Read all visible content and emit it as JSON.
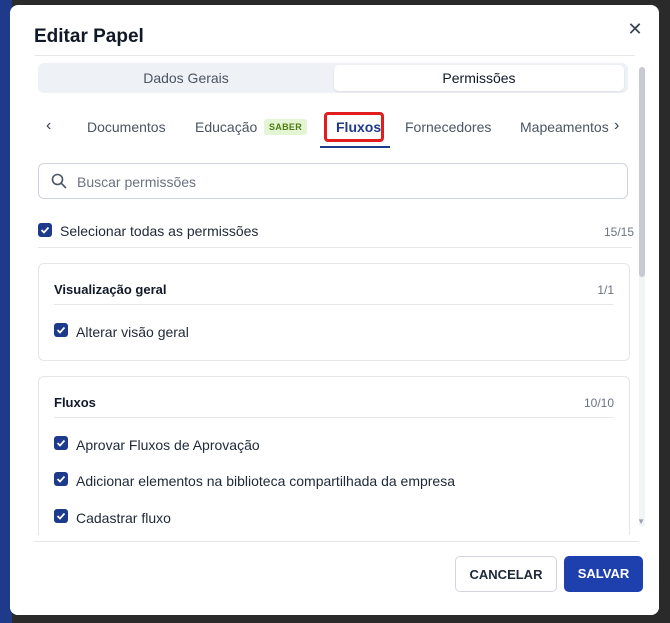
{
  "dialog": {
    "title": "Editar Papel"
  },
  "segments": [
    "Dados Gerais",
    "Permissões"
  ],
  "tabs": {
    "items": [
      "Documentos",
      "Educação",
      "Fluxos",
      "Fornecedores",
      "Mapeamentos"
    ],
    "badge": "SABER",
    "active": "Fluxos"
  },
  "search": {
    "placeholder": "Buscar permissões"
  },
  "select_all": {
    "label": "Selecionar todas as permissões",
    "count": "15/15"
  },
  "groups": [
    {
      "title": "Visualização geral",
      "count": "1/1",
      "items": [
        "Alterar visão geral"
      ]
    },
    {
      "title": "Fluxos",
      "count": "10/10",
      "items": [
        "Aprovar Fluxos de Aprovação",
        "Adicionar elementos na biblioteca compartilhada da empresa",
        "Cadastrar fluxo"
      ]
    }
  ],
  "buttons": {
    "cancel": "CANCELAR",
    "save": "SALVAR"
  },
  "colors": {
    "primary": "#1e40af",
    "highlight": "#e11d1d",
    "badge_bg": "#e3f5d5"
  },
  "icons": {
    "close": "close-icon",
    "search": "search-icon",
    "check": "check-icon",
    "prev": "chevron-left-icon",
    "next": "chevron-right-icon"
  }
}
